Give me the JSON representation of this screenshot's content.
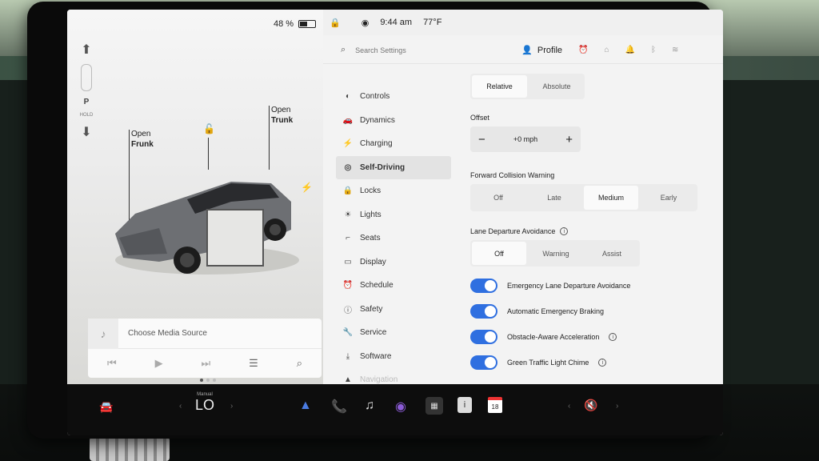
{
  "status": {
    "battery": "48 %",
    "time": "9:44 am",
    "temperature": "77°F"
  },
  "car": {
    "gear": "P",
    "hold": "HOLD",
    "frunk_open": "Open",
    "frunk_label": "Frunk",
    "trunk_open": "Open",
    "trunk_label": "Trunk"
  },
  "media": {
    "source_text": "Choose Media Source"
  },
  "search": {
    "placeholder": "Search Settings"
  },
  "profile": {
    "label": "Profile"
  },
  "menu": [
    {
      "label": "Controls",
      "icon": "toggle-icon"
    },
    {
      "label": "Dynamics",
      "icon": "car-icon"
    },
    {
      "label": "Charging",
      "icon": "bolt-icon"
    },
    {
      "label": "Self-Driving",
      "icon": "steering-wheel-icon",
      "active": true
    },
    {
      "label": "Locks",
      "icon": "lock-icon"
    },
    {
      "label": "Lights",
      "icon": "sun-icon"
    },
    {
      "label": "Seats",
      "icon": "seat-icon"
    },
    {
      "label": "Display",
      "icon": "display-icon"
    },
    {
      "label": "Schedule",
      "icon": "alarm-icon"
    },
    {
      "label": "Safety",
      "icon": "info-icon"
    },
    {
      "label": "Service",
      "icon": "wrench-icon"
    },
    {
      "label": "Software",
      "icon": "download-icon"
    },
    {
      "label": "Navigation",
      "icon": "navigation-icon"
    }
  ],
  "settings": {
    "speed_mode": {
      "options": [
        "Relative",
        "Absolute"
      ],
      "selected": "Relative"
    },
    "offset": {
      "label": "Offset",
      "value": "+0 mph",
      "minus": "−",
      "plus": "+"
    },
    "fcw": {
      "label": "Forward Collision Warning",
      "options": [
        "Off",
        "Late",
        "Medium",
        "Early"
      ],
      "selected": "Medium"
    },
    "lda": {
      "label": "Lane Departure Avoidance",
      "options": [
        "Off",
        "Warning",
        "Assist"
      ],
      "selected": "Off"
    },
    "toggles": [
      {
        "label": "Emergency Lane Departure Avoidance",
        "on": true,
        "info": false
      },
      {
        "label": "Automatic Emergency Braking",
        "on": true,
        "info": false
      },
      {
        "label": "Obstacle-Aware Acceleration",
        "on": true,
        "info": true
      },
      {
        "label": "Green Traffic Light Chime",
        "on": true,
        "info": true
      }
    ]
  },
  "dock": {
    "climate_mode": "Manual",
    "climate_value": "LO",
    "calendar_day": "18"
  },
  "colors": {
    "accent": "#2f6fe0",
    "alarm": "#e0892b"
  }
}
